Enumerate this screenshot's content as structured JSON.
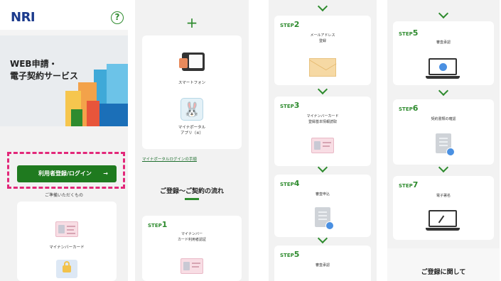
{
  "col1": {
    "logo": "NRI",
    "help_icon": "?",
    "hero_title": "WEB申請・\n電子契約サービス",
    "login_button": "利用者登録/ログイン",
    "login_arrow": "→",
    "prep_heading": "ご準備いただくもの",
    "card_label": "マイナンバーカード"
  },
  "col2": {
    "plus": "+",
    "smartphone_label": "スマートフォン",
    "portal_app_label": "マイナポータル\nアプリ（※）",
    "portal_link": "マイナポータルログインの手順",
    "flow_title": "ご登録〜ご契約の流れ",
    "step1": {
      "prefix": "STEP",
      "num": "1",
      "text": "マイナンバー\nカード利用者認証"
    }
  },
  "col3": {
    "step2": {
      "prefix": "STEP",
      "num": "2",
      "text": "メールアドレス\n登録"
    },
    "step3": {
      "prefix": "STEP",
      "num": "3",
      "text": "マイナンバーカード\n登録基本情報読取"
    },
    "step4": {
      "prefix": "STEP",
      "num": "4",
      "text": "審査申込"
    },
    "step5": {
      "prefix": "STEP",
      "num": "5",
      "text": "審査承認"
    }
  },
  "col4": {
    "step5": {
      "prefix": "STEP",
      "num": "5",
      "text": "審査承認"
    },
    "step6": {
      "prefix": "STEP",
      "num": "6",
      "text": "契約書類の確認"
    },
    "step7": {
      "prefix": "STEP",
      "num": "7",
      "text": "電子署名"
    },
    "about_title": "ご登録に関して"
  },
  "colors": {
    "green": "#2e8b2e",
    "button_green": "#1f7a1f",
    "highlight_pink": "#e2287a",
    "logo_blue": "#1b3a8c"
  }
}
